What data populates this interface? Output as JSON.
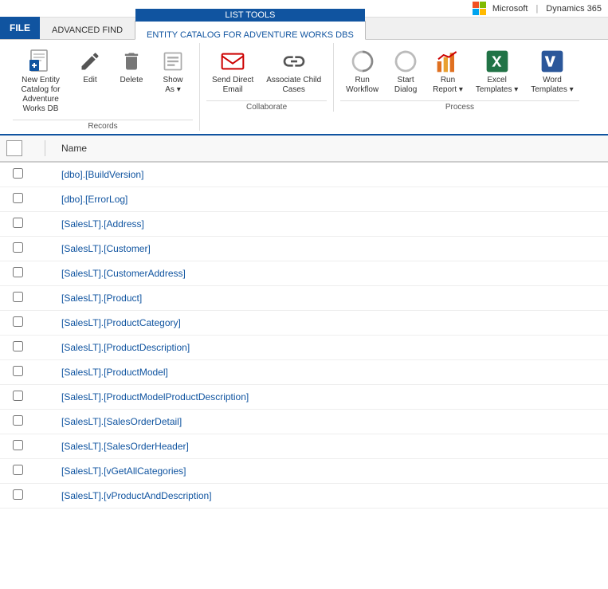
{
  "topbar": {
    "microsoft_label": "Microsoft",
    "dynamics_label": "Dynamics 365",
    "separator": "|"
  },
  "ribbon_tabs": {
    "file_label": "FILE",
    "advanced_find_label": "ADVANCED FIND",
    "list_tools_label": "LIST TOOLS",
    "entity_catalog_label": "ENTITY CATALOG FOR ADVENTURE WORKS DBS"
  },
  "ribbon_groups": {
    "records": {
      "label": "Records",
      "buttons": [
        {
          "id": "new-entity",
          "label": "New Entity Catalog for Adventure Works\nDB",
          "icon": "new-entity-icon"
        },
        {
          "id": "edit",
          "label": "Edit",
          "icon": "edit-icon"
        },
        {
          "id": "delete",
          "label": "Delete",
          "icon": "delete-icon"
        },
        {
          "id": "show-as",
          "label": "Show\nAs ▾",
          "icon": "show-as-icon"
        }
      ]
    },
    "collaborate": {
      "label": "Collaborate",
      "buttons": [
        {
          "id": "send-direct-email",
          "label": "Send Direct\nEmail",
          "icon": "send-email-icon"
        },
        {
          "id": "associate-child-cases",
          "label": "Associate Child\nCases",
          "icon": "associate-icon"
        }
      ]
    },
    "process": {
      "label": "Process",
      "buttons": [
        {
          "id": "run-workflow",
          "label": "Run\nWorkflow",
          "icon": "run-workflow-icon"
        },
        {
          "id": "start-dialog",
          "label": "Start\nDialog",
          "icon": "start-dialog-icon"
        },
        {
          "id": "run-report",
          "label": "Run\nReport ▾",
          "icon": "run-report-icon"
        },
        {
          "id": "excel-templates",
          "label": "Excel\nTemplates ▾",
          "icon": "excel-icon"
        },
        {
          "id": "word-templates",
          "label": "Word\nTemplates ▾",
          "icon": "word-icon"
        }
      ]
    }
  },
  "grid": {
    "header": {
      "name_label": "Name"
    },
    "rows": [
      {
        "id": 1,
        "name": "[dbo].[BuildVersion]"
      },
      {
        "id": 2,
        "name": "[dbo].[ErrorLog]"
      },
      {
        "id": 3,
        "name": "[SalesLT].[Address]"
      },
      {
        "id": 4,
        "name": "[SalesLT].[Customer]"
      },
      {
        "id": 5,
        "name": "[SalesLT].[CustomerAddress]"
      },
      {
        "id": 6,
        "name": "[SalesLT].[Product]"
      },
      {
        "id": 7,
        "name": "[SalesLT].[ProductCategory]"
      },
      {
        "id": 8,
        "name": "[SalesLT].[ProductDescription]"
      },
      {
        "id": 9,
        "name": "[SalesLT].[ProductModel]"
      },
      {
        "id": 10,
        "name": "[SalesLT].[ProductModelProductDescription]"
      },
      {
        "id": 11,
        "name": "[SalesLT].[SalesOrderDetail]"
      },
      {
        "id": 12,
        "name": "[SalesLT].[SalesOrderHeader]"
      },
      {
        "id": 13,
        "name": "[SalesLT].[vGetAllCategories]"
      },
      {
        "id": 14,
        "name": "[SalesLT].[vProductAndDescription]"
      }
    ]
  },
  "colors": {
    "accent_blue": "#1054a0",
    "link_blue": "#1054a0",
    "header_bg": "#f0f0f0",
    "ribbon_bg": "#ffffff"
  }
}
